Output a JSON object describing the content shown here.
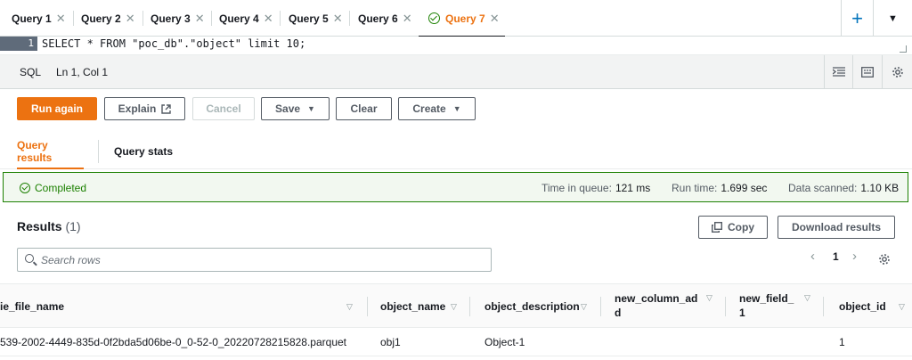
{
  "tabs": [
    {
      "label": "Query 1",
      "active": false
    },
    {
      "label": "Query 2",
      "active": false
    },
    {
      "label": "Query 3",
      "active": false
    },
    {
      "label": "Query 4",
      "active": false
    },
    {
      "label": "Query 5",
      "active": false
    },
    {
      "label": "Query 6",
      "active": false
    },
    {
      "label": "Query 7",
      "active": true
    }
  ],
  "editor": {
    "line_number": "1",
    "code": "SELECT * FROM \"poc_db\".\"object\" limit 10;"
  },
  "status": {
    "language": "SQL",
    "cursor": "Ln 1, Col 1"
  },
  "toolbar": {
    "run_again": "Run again",
    "explain": "Explain",
    "cancel": "Cancel",
    "save": "Save",
    "clear": "Clear",
    "create": "Create"
  },
  "subtabs": {
    "results": "Query results",
    "stats": "Query stats"
  },
  "banner": {
    "state": "Completed",
    "queue_label": "Time in queue:",
    "queue_value": "121 ms",
    "run_label": "Run time:",
    "run_value": "1.699 sec",
    "scanned_label": "Data scanned:",
    "scanned_value": "1.10 KB"
  },
  "results": {
    "title": "Results",
    "count": "(1)",
    "copy": "Copy",
    "download": "Download results",
    "search_placeholder": "Search rows",
    "page": "1"
  },
  "table": {
    "columns": [
      {
        "label": "ie_file_name"
      },
      {
        "label": "object_name"
      },
      {
        "label": "object_description"
      },
      {
        "label": "new_column_ad",
        "label2": "d"
      },
      {
        "label": "new_field_",
        "label2": "1"
      },
      {
        "label": "object_id"
      }
    ],
    "rows": [
      [
        "539-2002-4449-835d-0f2bda5d06be-0_0-52-0_20220728215828.parquet",
        "obj1",
        "Object-1",
        "",
        "",
        "1"
      ]
    ]
  },
  "colors": {
    "accent": "#ec7211",
    "success": "#1d8102",
    "link": "#0073bb"
  }
}
